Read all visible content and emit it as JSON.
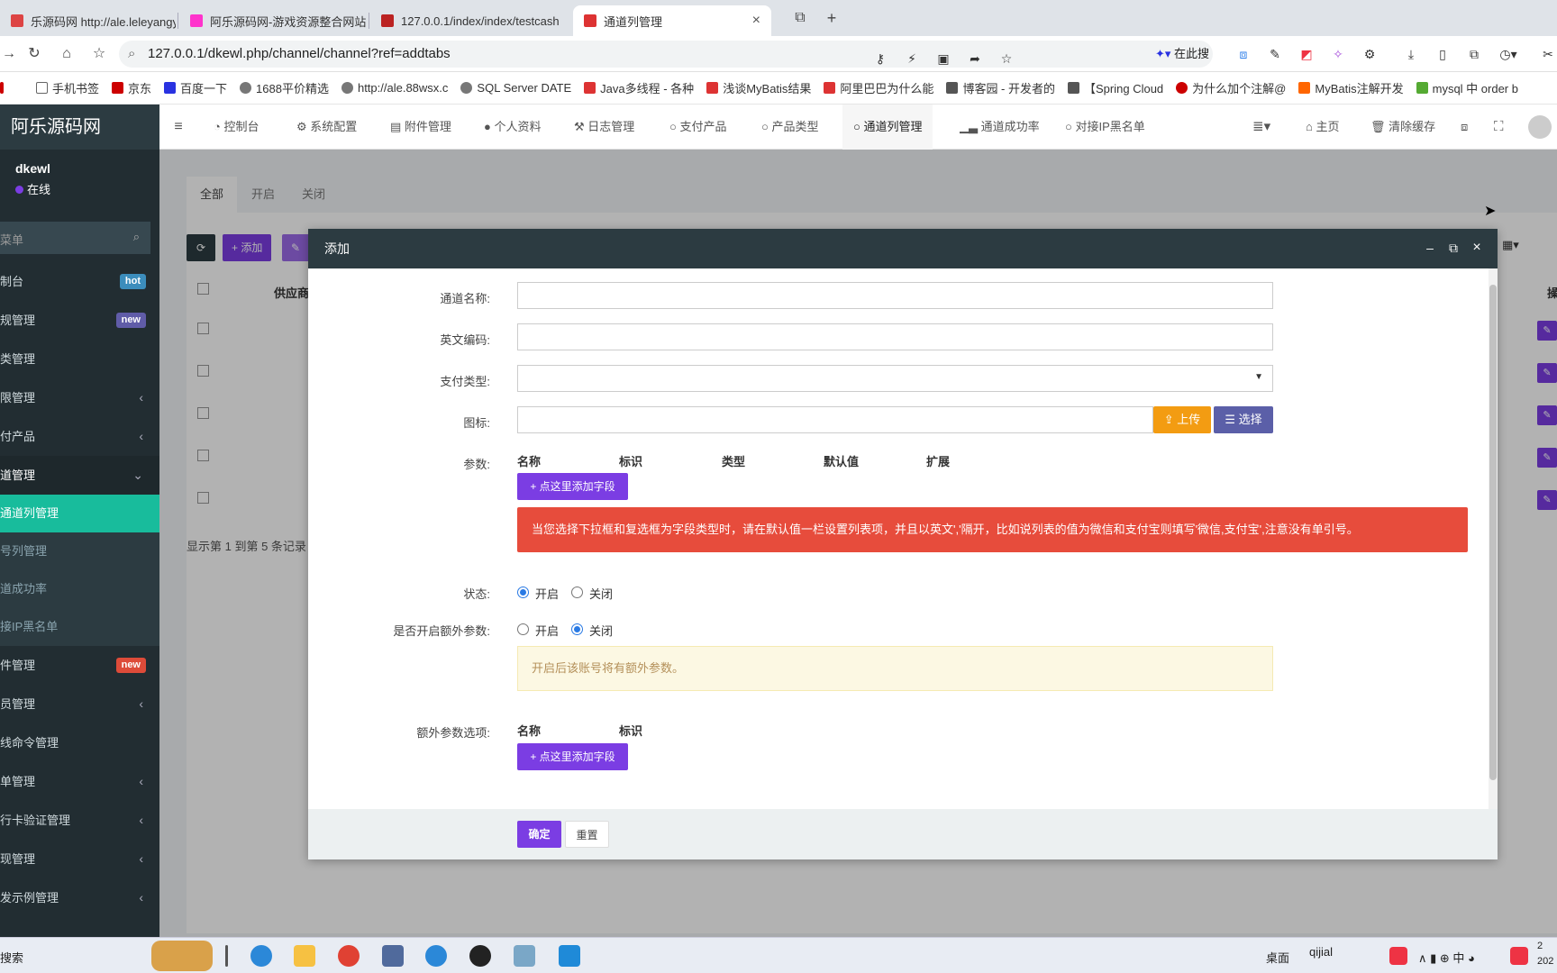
{
  "browser": {
    "tabs": [
      {
        "label": "乐源码网 http://ale.leleyangya",
        "color": "#d44"
      },
      {
        "label": "阿乐源码网-游戏资源整合网站,看",
        "color": "#e88"
      },
      {
        "label": "127.0.0.1/index/index/testcash",
        "color": "#b22"
      },
      {
        "label": "通道列管理",
        "color": "#d33"
      }
    ],
    "url": "127.0.0.1/dkewl.php/channel/channel?ref=addtabs",
    "search_label": "在此搜索",
    "bookmarks": [
      {
        "label": "手机书签",
        "color": "#fff"
      },
      {
        "label": "京东",
        "color": "#c00"
      },
      {
        "label": "百度一下",
        "color": "#2932e1"
      },
      {
        "label": "1688平价精选",
        "color": "#666"
      },
      {
        "label": "http://ale.88wsx.c",
        "color": "#666"
      },
      {
        "label": "SQL Server DATE",
        "color": "#666"
      },
      {
        "label": "Java多线程 - 各种",
        "color": "#d33"
      },
      {
        "label": "浅谈MyBatis结果",
        "color": "#d33"
      },
      {
        "label": "阿里巴巴为什么能",
        "color": "#d33"
      },
      {
        "label": "博客园 - 开发者的",
        "color": "#555"
      },
      {
        "label": "【Spring Cloud",
        "color": "#555"
      },
      {
        "label": "为什么加个注解@",
        "color": "#c00"
      },
      {
        "label": "MyBatis注解开发",
        "color": "#f60"
      },
      {
        "label": "mysql 中 order b",
        "color": "#5a3"
      }
    ]
  },
  "sidebar": {
    "logo": "阿乐源码网",
    "user_name": "dkewl",
    "user_status": "在线",
    "search_placeholder": "菜单",
    "items": [
      {
        "label": "制台",
        "badge": "hot",
        "badge_color": "#3c8dbc"
      },
      {
        "label": "规管理",
        "badge": "new",
        "badge_color": "#605ca8"
      },
      {
        "label": "类管理"
      },
      {
        "label": "限管理",
        "chevron": "‹"
      },
      {
        "label": "付产品",
        "chevron": "‹"
      },
      {
        "label": "道管理",
        "chevron": "⌄"
      }
    ],
    "sub_items": [
      {
        "label": "通道列管理"
      },
      {
        "label": "号列管理"
      },
      {
        "label": "道成功率"
      },
      {
        "label": "接IP黑名单"
      }
    ],
    "items_after": [
      {
        "label": "件管理",
        "badge": "new",
        "badge_color": "#dd4b39"
      },
      {
        "label": "员管理",
        "chevron": "‹"
      },
      {
        "label": "线命令管理"
      },
      {
        "label": "单管理",
        "chevron": "‹"
      },
      {
        "label": "行卡验证管理",
        "chevron": "‹"
      },
      {
        "label": "现管理",
        "chevron": "‹"
      },
      {
        "label": "发示例管理",
        "chevron": "‹"
      }
    ]
  },
  "topnav": {
    "items": [
      "控制台",
      "系统配置",
      "附件管理",
      "个人资料",
      "日志管理",
      "支付产品",
      "产品类型",
      "通道列管理",
      "通道成功率",
      "对接IP黑名单"
    ],
    "right": [
      "主页",
      "清除缓存"
    ]
  },
  "content": {
    "tabs": [
      "全部",
      "开启",
      "关闭"
    ],
    "add_label": "添加",
    "col_supplier": "供应商",
    "col_action": "操",
    "pager_text": "显示第 1 到第 5 条记录"
  },
  "modal": {
    "title": "添加",
    "fields": {
      "name_label": "通道名称:",
      "code_label": "英文编码:",
      "paytype_label": "支付类型:",
      "icon_label": "图标:",
      "params_label": "参数:",
      "status_label": "状态:",
      "extra_label": "是否开启额外参数:",
      "extra_opts_label": "额外参数选项:"
    },
    "upload_label": "上传",
    "choose_label": "选择",
    "param_cols": [
      "名称",
      "标识",
      "类型",
      "默认值",
      "扩展"
    ],
    "extra_cols": [
      "名称",
      "标识"
    ],
    "add_field_label": "点这里添加字段",
    "warning": "当您选择下拉框和复选框为字段类型时，请在默认值一栏设置列表项，并且以英文','隔开，比如说列表的值为微信和支付宝则填写'微信,支付宝',注意没有单引号。",
    "status_on": "开启",
    "status_off": "关闭",
    "status_value": "开启",
    "extra_value": "关闭",
    "note": "开启后该账号将有额外参数。",
    "confirm_label": "确定",
    "reset_label": "重置"
  },
  "taskbar": {
    "search": "搜索",
    "desktop": "桌面",
    "user": "qijial",
    "time": "2",
    "date": "202"
  }
}
